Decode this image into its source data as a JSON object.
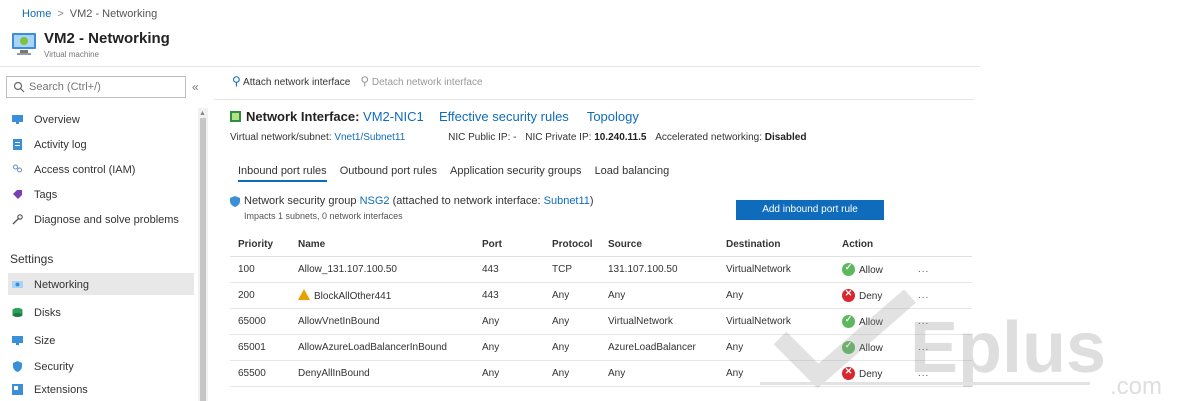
{
  "breadcrumb": {
    "home": "Home",
    "separator": ">",
    "current": "VM2 - Networking"
  },
  "header": {
    "title": "VM2 - Networking",
    "subtitle": "Virtual machine"
  },
  "sidebar": {
    "search_placeholder": "Search (Ctrl+/)",
    "collapse_label": "«",
    "items": [
      {
        "label": "Overview",
        "icon": "monitor-icon"
      },
      {
        "label": "Activity log",
        "icon": "activity-log-icon"
      },
      {
        "label": "Access control (IAM)",
        "icon": "iam-icon"
      },
      {
        "label": "Tags",
        "icon": "tag-icon"
      },
      {
        "label": "Diagnose and solve problems",
        "icon": "wrench-icon"
      }
    ],
    "settings_header": "Settings",
    "settings_items": [
      {
        "label": "Networking",
        "icon": "networking-icon",
        "active": true
      },
      {
        "label": "Disks",
        "icon": "disks-icon"
      },
      {
        "label": "Size",
        "icon": "size-icon"
      },
      {
        "label": "Security",
        "icon": "shield-icon"
      },
      {
        "label": "Extensions",
        "icon": "extensions-icon"
      }
    ]
  },
  "toolbar": {
    "attach_label": "Attach network interface",
    "detach_label": "Detach network interface"
  },
  "nic": {
    "title_prefix": "Network Interface:",
    "name": "VM2-NIC1",
    "effective_rules_link": "Effective security rules",
    "topology_link": "Topology",
    "vnet_label": "Virtual network/subnet:",
    "vnet_value": "Vnet1/Subnet11",
    "public_ip_label": "NIC Public IP:",
    "public_ip_value": "-",
    "private_ip_label": "NIC Private IP:",
    "private_ip_value": "10.240.11.5",
    "accel_label": "Accelerated networking:",
    "accel_value": "Disabled"
  },
  "tabs": [
    "Inbound port rules",
    "Outbound port rules",
    "Application security groups",
    "Load balancing"
  ],
  "nsg": {
    "prefix": "Network security group",
    "name": "NSG2",
    "attached_text": "(attached to network interface:",
    "subnet": "Subnet11",
    "close": ")",
    "impacts": "Impacts 1 subnets, 0 network interfaces",
    "add_button": "Add inbound port rule"
  },
  "rules_table": {
    "columns": [
      "Priority",
      "Name",
      "Port",
      "Protocol",
      "Source",
      "Destination",
      "Action"
    ],
    "rows": [
      {
        "priority": "100",
        "name": "Allow_131.107.100.50",
        "warning": false,
        "port": "443",
        "protocol": "TCP",
        "source": "131.107.100.50",
        "destination": "VirtualNetwork",
        "action": "Allow"
      },
      {
        "priority": "200",
        "name": "BlockAllOther441",
        "warning": true,
        "port": "443",
        "protocol": "Any",
        "source": "Any",
        "destination": "Any",
        "action": "Deny"
      },
      {
        "priority": "65000",
        "name": "AllowVnetInBound",
        "warning": false,
        "port": "Any",
        "protocol": "Any",
        "source": "VirtualNetwork",
        "destination": "VirtualNetwork",
        "action": "Allow"
      },
      {
        "priority": "65001",
        "name": "AllowAzureLoadBalancerInBound",
        "warning": false,
        "port": "Any",
        "protocol": "Any",
        "source": "AzureLoadBalancer",
        "destination": "Any",
        "action": "Allow"
      },
      {
        "priority": "65500",
        "name": "DenyAllInBound",
        "warning": false,
        "port": "Any",
        "protocol": "Any",
        "source": "Any",
        "destination": "Any",
        "action": "Deny"
      }
    ],
    "more_label": "..."
  },
  "colors": {
    "link": "#0f6cbd",
    "allow": "#5cb85c",
    "deny": "#d9262f",
    "warning": "#e8a000"
  }
}
